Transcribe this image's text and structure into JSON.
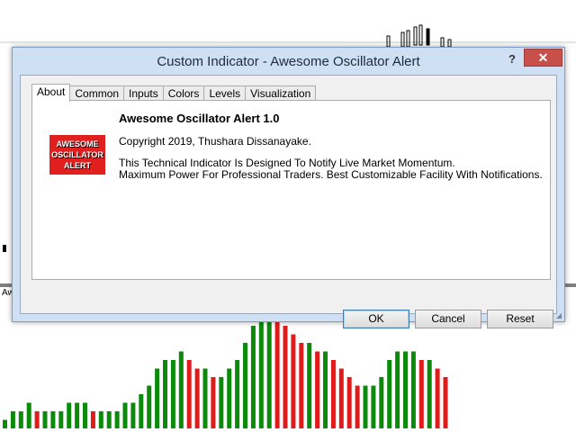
{
  "background": {
    "label": "Aw",
    "bar_colors": {
      "up": "#0b8a0b",
      "down": "#e01b1b"
    }
  },
  "chart_data": {
    "type": "bar",
    "title": "",
    "categories": [],
    "series": [
      {
        "values": [
          1,
          2,
          2,
          3,
          2,
          2,
          2,
          2,
          3,
          3,
          3,
          2,
          2,
          2,
          2,
          3,
          3,
          4,
          5,
          7,
          8,
          8,
          9,
          8,
          7,
          7,
          6,
          6,
          7,
          8,
          10,
          12,
          13,
          14,
          13,
          12,
          11,
          10,
          10,
          9,
          9,
          8,
          7,
          6,
          5,
          5,
          5,
          6,
          8,
          9,
          9,
          9,
          8,
          8,
          7,
          6
        ]
      }
    ]
  },
  "dialog": {
    "title": "Custom Indicator - Awesome Oscillator Alert",
    "help_label": "?",
    "close_label": "✕",
    "tabs": [
      "About",
      "Common",
      "Inputs",
      "Colors",
      "Levels",
      "Visualization"
    ],
    "active_tab": "About",
    "logo_lines": [
      "AWESOME",
      "OSCILLATOR",
      "ALERT"
    ],
    "about_title": "Awesome Oscillator Alert 1.0",
    "copyright": "Copyright 2019, Thushara Dissanayake.",
    "desc_line1": "This Technical Indicator Is Designed To Notify Live Market Momentum.",
    "desc_line2": "Maximum Power For Professional Traders. Best Customizable Facility With Notifications.",
    "buttons": {
      "ok": "OK",
      "cancel": "Cancel",
      "reset": "Reset"
    }
  }
}
